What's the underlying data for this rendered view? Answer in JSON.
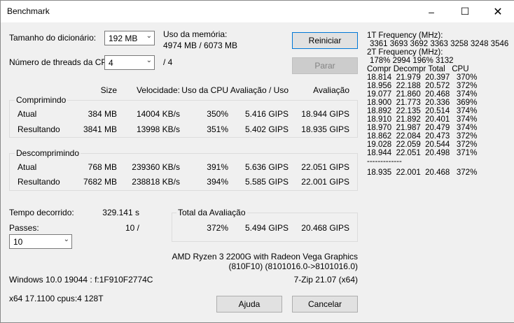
{
  "window": {
    "title": "Benchmark"
  },
  "titlebar": {
    "minimize_icon": "minimize-icon",
    "maximize_icon": "maximize-icon",
    "close_icon": "close-icon"
  },
  "dict": {
    "label": "Tamanho do dicionário:",
    "value": "192 MB"
  },
  "threads": {
    "label": "Número de threads da CPU:",
    "value": "4",
    "total": "/ 4"
  },
  "memory": {
    "label": "Uso da memória:",
    "value": "4974 MB / 6073 MB"
  },
  "buttons": {
    "restart": "Reiniciar",
    "stop": "Parar",
    "help": "Ajuda",
    "cancel": "Cancelar"
  },
  "headers": {
    "size": "Size",
    "speed": "Velocidade:",
    "cpu": "Uso da CPU",
    "rating_use": "Avaliação / Uso",
    "rating": "Avaliação"
  },
  "compress": {
    "title": "Comprimindo",
    "current": {
      "label": "Atual",
      "size": "384 MB",
      "speed": "14004 KB/s",
      "cpu": "350%",
      "rating_use": "5.416 GIPS",
      "rating": "18.944 GIPS"
    },
    "result": {
      "label": "Resultando",
      "size": "3841 MB",
      "speed": "13998 KB/s",
      "cpu": "351%",
      "rating_use": "5.402 GIPS",
      "rating": "18.935 GIPS"
    }
  },
  "decompress": {
    "title": "Descomprimindo",
    "current": {
      "label": "Atual",
      "size": "768 MB",
      "speed": "239360 KB/s",
      "cpu": "391%",
      "rating_use": "5.636 GIPS",
      "rating": "22.051 GIPS"
    },
    "result": {
      "label": "Resultando",
      "size": "7682 MB",
      "speed": "238818 KB/s",
      "cpu": "394%",
      "rating_use": "5.585 GIPS",
      "rating": "22.001 GIPS"
    }
  },
  "elapsed": {
    "label": "Tempo decorrido:",
    "value": "329.141 s"
  },
  "passes": {
    "label": "Passes:",
    "value": "10 /",
    "select": "10"
  },
  "total": {
    "title": "Total da Avaliação",
    "cpu": "372%",
    "rating_use": "5.494 GIPS",
    "rating": "20.468 GIPS"
  },
  "cpu_info": {
    "line1": "AMD Ryzen 3 2200G with Radeon Vega Graphics",
    "line2": "(810F10) (8101016.0->8101016.0)"
  },
  "sys": {
    "os": "Windows 10.0 19044 : f:1F910F2774C",
    "version": "7-Zip 21.07 (x64)",
    "arch": "x64 17.1100 cpus:4 128T"
  },
  "side": {
    "f1_label": "1T Frequency (MHz):",
    "f1_values": "3361 3693 3692 3363 3258 3248 3546",
    "f2_label": "2T Frequency (MHz):",
    "f2_values": "178% 2994 196% 3132",
    "col_header": "Compr Decompr Total   CPU",
    "rows": [
      "18.814  21.979  20.397   370%",
      "18.956  22.188  20.572   372%",
      "19.077  21.860  20.468   374%",
      "18.900  21.773  20.336   369%",
      "18.892  22.135  20.514   374%",
      "18.910  21.892  20.401   374%",
      "18.970  21.987  20.479   374%",
      "18.862  22.084  20.473   372%",
      "19.028  22.059  20.544   372%",
      "18.944  22.051  20.498   371%"
    ],
    "separator": "-------------",
    "summary": "18.935  22.001  20.468   372%"
  }
}
